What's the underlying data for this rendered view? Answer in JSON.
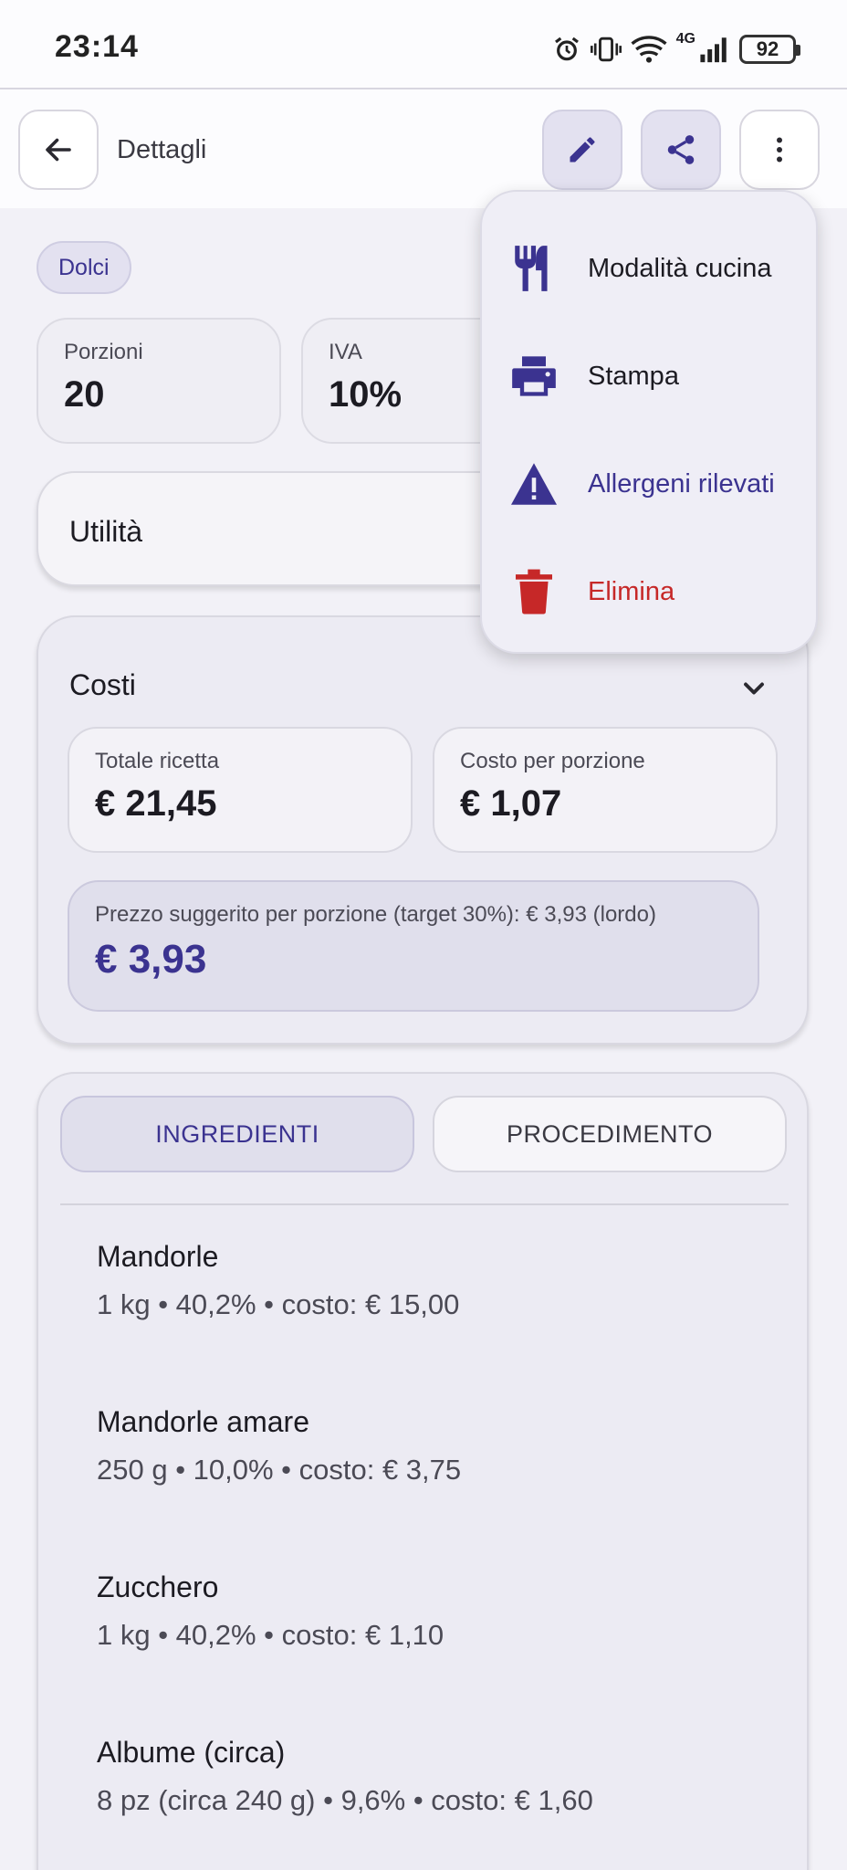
{
  "status_bar": {
    "time": "23:14",
    "network": "4G",
    "battery": "92"
  },
  "appbar": {
    "title": "Dettagli"
  },
  "category_chip": "Dolci",
  "stats": [
    {
      "label": "Porzioni",
      "value": "20"
    },
    {
      "label": "IVA",
      "value": "10%"
    }
  ],
  "utilita": {
    "title": "Utilità"
  },
  "costi": {
    "title": "Costi",
    "totale_label": "Totale ricetta",
    "totale_value": "€ 21,45",
    "porzione_label": "Costo per porzione",
    "porzione_value": "€ 1,07",
    "suggerito_label": "Prezzo suggerito per porzione (target 30%): € 3,93 (lordo)",
    "suggerito_value": "€ 3,93"
  },
  "tabs": {
    "ingredienti": "INGREDIENTI",
    "procedimento": "PROCEDIMENTO"
  },
  "ingredients": [
    {
      "name": "Mandorle",
      "detail": "1 kg • 40,2% • costo: € 15,00"
    },
    {
      "name": "Mandorle amare",
      "detail": "250 g • 10,0% • costo: € 3,75"
    },
    {
      "name": "Zucchero",
      "detail": "1 kg • 40,2% • costo: € 1,10"
    },
    {
      "name": "Albume (circa)",
      "detail": "8 pz (circa 240 g) • 9,6% • costo: € 1,60"
    }
  ],
  "menu": {
    "items": [
      {
        "label": "Modalità cucina",
        "icon": "restaurant-icon"
      },
      {
        "label": "Stampa",
        "icon": "print-icon"
      },
      {
        "label": "Allergeni rilevati",
        "icon": "warning-icon"
      },
      {
        "label": "Elimina",
        "icon": "delete-icon"
      }
    ]
  },
  "colors": {
    "accent": "#3b3390",
    "danger": "#c62828",
    "background": "#f2f1f7"
  }
}
